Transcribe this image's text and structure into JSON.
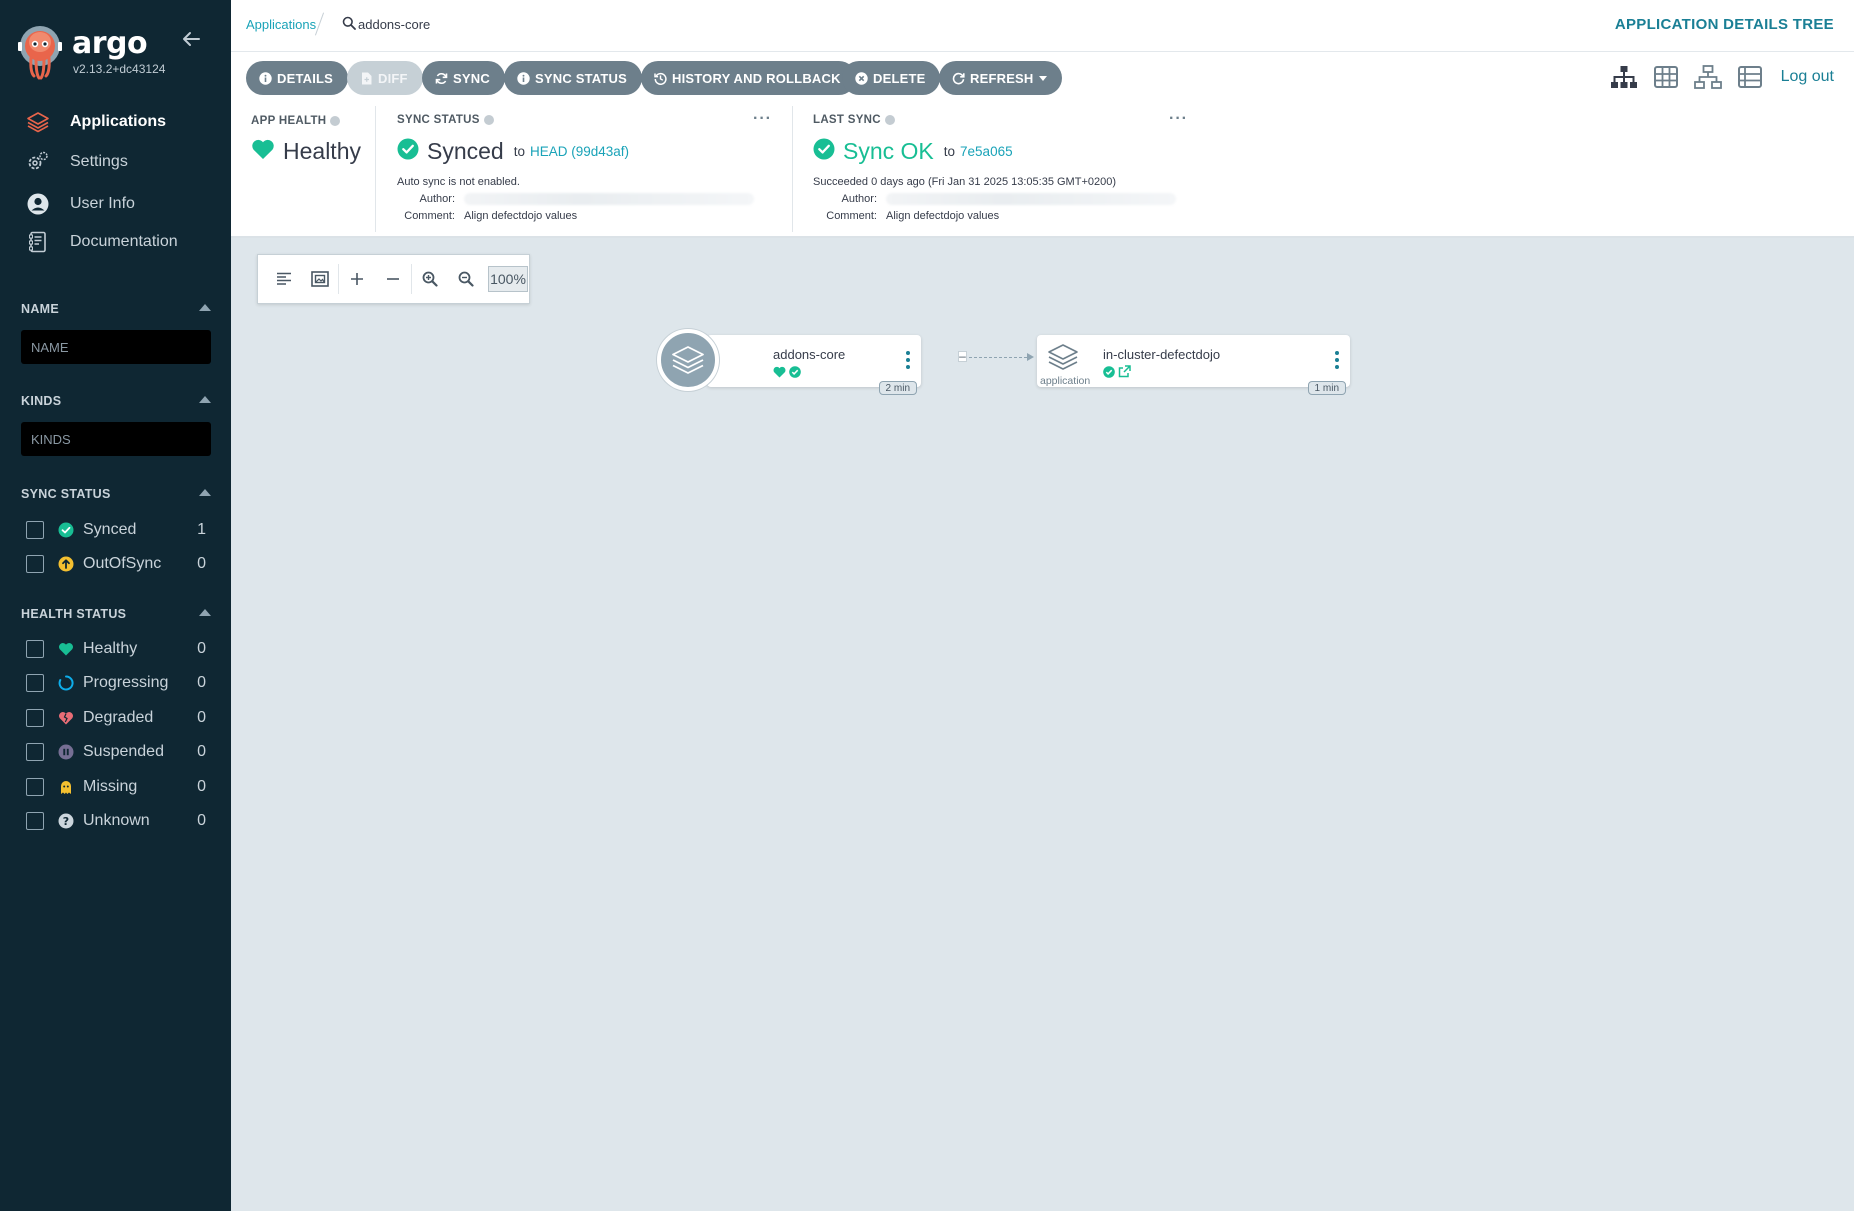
{
  "app": {
    "brand": "argo",
    "version": "v2.13.2+dc43124"
  },
  "nav": [
    {
      "label": "Applications",
      "icon": "layers-icon",
      "active": true
    },
    {
      "label": "Settings",
      "icon": "gears-icon"
    },
    {
      "label": "User Info",
      "icon": "user-circle-icon"
    },
    {
      "label": "Documentation",
      "icon": "book-icon"
    }
  ],
  "filters": {
    "name": {
      "heading": "NAME",
      "placeholder": "NAME"
    },
    "kinds": {
      "heading": "KINDS",
      "placeholder": "KINDS"
    },
    "sync_status": {
      "heading": "SYNC STATUS",
      "items": [
        {
          "label": "Synced",
          "count": "1",
          "icon": "check-circle-icon",
          "color": "#18be94"
        },
        {
          "label": "OutOfSync",
          "count": "0",
          "icon": "arrow-up-circle-icon",
          "color": "#f4c030"
        }
      ]
    },
    "health_status": {
      "heading": "HEALTH STATUS",
      "items": [
        {
          "label": "Healthy",
          "count": "0",
          "icon": "heart-icon",
          "color": "#18be94"
        },
        {
          "label": "Progressing",
          "count": "0",
          "icon": "progress-ring-icon",
          "color": "#0dadea"
        },
        {
          "label": "Degraded",
          "count": "0",
          "icon": "heart-broken-icon",
          "color": "#e96d76"
        },
        {
          "label": "Suspended",
          "count": "0",
          "icon": "pause-circle-icon",
          "color": "#766f94"
        },
        {
          "label": "Missing",
          "count": "0",
          "icon": "ghost-icon",
          "color": "#f4c030"
        },
        {
          "label": "Unknown",
          "count": "0",
          "icon": "question-circle-icon",
          "color": "#ccd6dd"
        }
      ]
    }
  },
  "breadcrumb": {
    "root": "Applications",
    "current": "addons-core"
  },
  "view_title": "APPLICATION DETAILS TREE",
  "toolbar": {
    "details": "DETAILS",
    "diff": "DIFF",
    "sync": "SYNC",
    "sync_status": "SYNC STATUS",
    "history": "HISTORY AND ROLLBACK",
    "delete": "DELETE",
    "refresh": "REFRESH",
    "logout": "Log out"
  },
  "status": {
    "health": {
      "title": "APP HEALTH",
      "value": "Healthy",
      "color": "#18be94"
    },
    "sync": {
      "title": "SYNC STATUS",
      "value": "Synced",
      "to": "to",
      "revision": "HEAD (99d43af)",
      "auto_sync": "Auto sync is not enabled.",
      "author_label": "Author:",
      "comment_label": "Comment:",
      "comment": "Align defectdojo values"
    },
    "last_sync": {
      "title": "LAST SYNC",
      "value": "Sync OK",
      "to": "to",
      "revision": "7e5a065",
      "succeeded": "Succeeded 0 days ago (Fri Jan 31 2025 13:05:35 GMT+0200)",
      "author_label": "Author:",
      "comment_label": "Comment:",
      "comment": "Align defectdojo values"
    },
    "menu": "···"
  },
  "zoom": {
    "level": "100%"
  },
  "tree": {
    "root": {
      "name": "addons-core",
      "age": "2 min"
    },
    "child": {
      "name": "in-cluster-defectdojo",
      "kind": "application",
      "age": "1 min"
    },
    "edge_marker": "–"
  },
  "colors": {
    "sidebar": "#0f2733",
    "accent": "#1aa3b8",
    "healthy": "#18be94",
    "button": "#6d7f8b",
    "canvas": "#dee6eb"
  }
}
